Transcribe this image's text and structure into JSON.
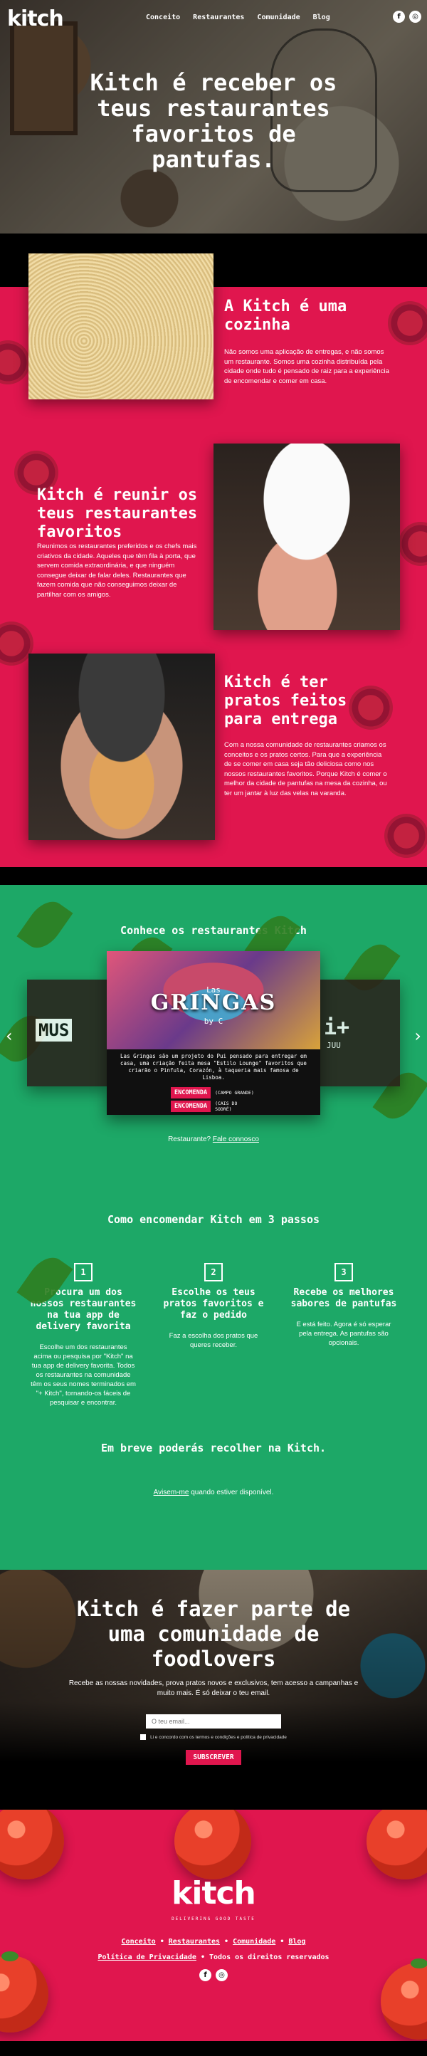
{
  "header": {
    "logo": "kitch",
    "nav": [
      "Conceito",
      "Restaurantes",
      "Comunidade",
      "Blog"
    ],
    "social": [
      {
        "icon": "facebook-icon",
        "glyph": "f"
      },
      {
        "icon": "instagram-icon",
        "glyph": "◎"
      }
    ]
  },
  "hero": {
    "title": "Kitch é receber os teus restaurantes favoritos de pantufas."
  },
  "features": [
    {
      "title": "A Kitch é uma cozinha",
      "text": "Não somos uma aplicação de entregas, e não somos um restaurante. Somos uma cozinha distribuída pela cidade onde tudo é pensado de raiz para a experiência de encomendar e comer em casa."
    },
    {
      "title": "Kitch é reunir os teus restaurantes favoritos",
      "text": "Reunimos os restaurantes preferidos e os chefs mais criativos da cidade. Aqueles que têm fila à porta, que servem comida extraordinária, e que ninguém consegue deixar de falar deles. Restaurantes que fazem comida que não conseguimos deixar de partilhar com os amigos."
    },
    {
      "title": "Kitch é ter pratos feitos para entrega",
      "text": "Com a nossa comunidade de restaurantes criamos os conceitos e os pratos certos. Para que a experiência de se comer em casa seja tão deliciosa como nos nossos restaurantes favoritos. Porque Kitch é comer o melhor da cidade de pantufas na mesa da cozinha, ou ter um jantar à luz das velas na varanda."
    }
  ],
  "restaurants": {
    "title": "Conhece os restaurantes Kitch",
    "left_card": "MUS",
    "right_card": "i+",
    "right_sub": "JUU",
    "featured": {
      "brand_top": "Las",
      "name": "GRINGAS",
      "brand_bottom": "by C",
      "description": "Las Gringas são um projeto do Pui pensado para entregar em casa, uma criação feita mesa \"Estilo Lounge\" favoritos que criarão o Pinfula, Corazón, à taqueria mais famosa de Lisboa.",
      "order_label": "ENCOMENDA",
      "order_1_sub": "(CAMPO GRANDE)",
      "order_2_sub": "(CAIS DO SODRÉ)"
    },
    "contact_text": "Restaurante?",
    "contact_link": "Fale connosco"
  },
  "how": {
    "title": "Como encomendar Kitch em 3 passos",
    "steps": [
      {
        "num": "1",
        "title": "Procura um dos nossos restaurantes na tua app de delivery favorita",
        "text": "Escolhe um dos restaurantes acima ou pesquisa por \"Kitch\" na tua app de delivery favorita. Todos os restaurantes na comunidade têm os seus nomes terminados em \"+ Kitch\", tornando-os fáceis de pesquisar e encontrar."
      },
      {
        "num": "2",
        "title": "Escolhe os teus pratos favoritos e faz o pedido",
        "text": "Faz a escolha dos pratos que queres receber."
      },
      {
        "num": "3",
        "title": "Recebe os melhores sabores de pantufas",
        "text": "E está feito. Agora é só esperar pela entrega. As pantufas são opcionais."
      }
    ],
    "pickup_title": "Em breve poderás recolher na Kitch.",
    "pickup_link": "Avisem-me",
    "pickup_rest": " quando estiver disponível."
  },
  "newsletter": {
    "title": "Kitch é fazer parte de uma comunidade de foodlovers",
    "subtitle": "Recebe as nossas novidades, prova pratos novos e exclusivos, tem acesso a campanhas e muito mais. É só deixar o teu email.",
    "placeholder": "O teu email...",
    "consent": "Li e concordo com os termos e condições e política de privacidade",
    "button": "SUBSCREVER"
  },
  "footer": {
    "logo": "kitch",
    "tagline": "DELIVERING GOOD TASTE",
    "nav": [
      "Conceito",
      "Restaurantes",
      "Comunidade",
      "Blog"
    ],
    "legal_link": "Política de Privacidade",
    "rights": "Todos os direitos reservados"
  },
  "colors": {
    "pink": "#e0164e",
    "green": "#1da867",
    "black": "#000000"
  }
}
